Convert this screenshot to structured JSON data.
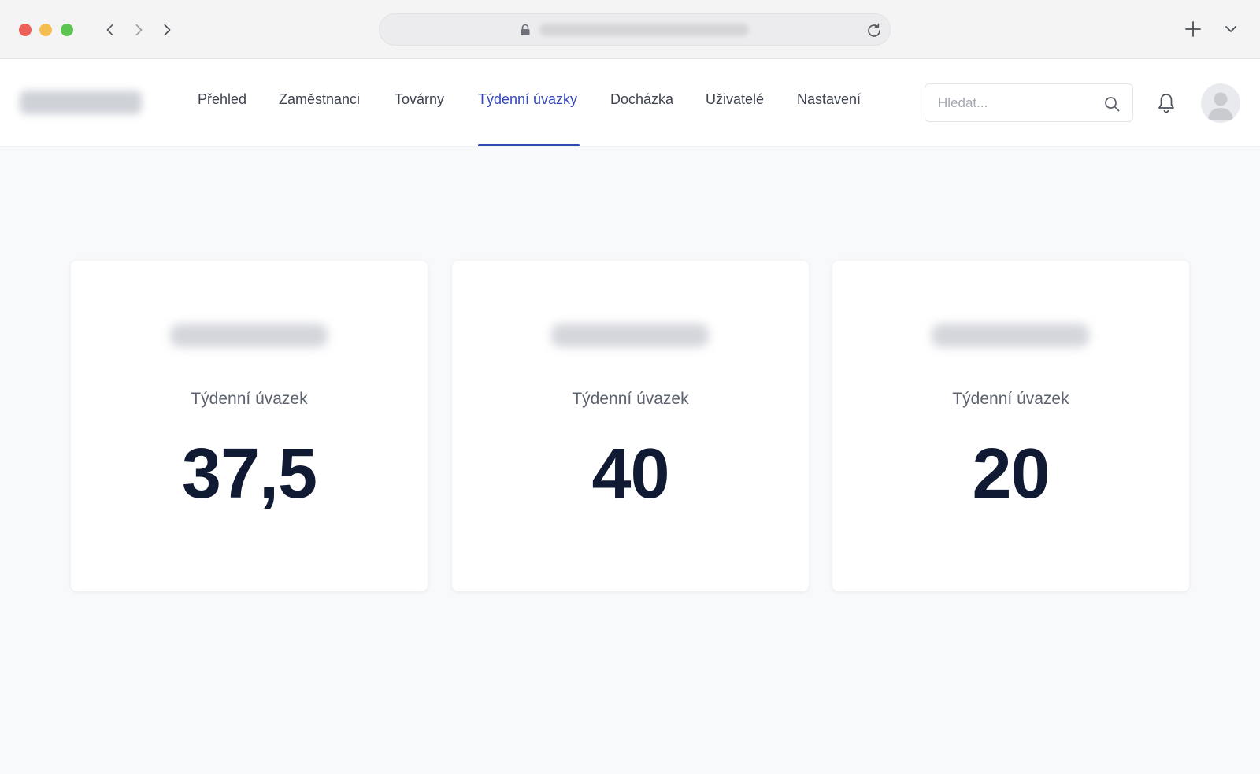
{
  "nav": {
    "items": [
      {
        "label": "Přehled"
      },
      {
        "label": "Zaměstnanci"
      },
      {
        "label": "Továrny"
      },
      {
        "label": "Týdenní úvazky"
      },
      {
        "label": "Docházka"
      },
      {
        "label": "Uživatelé"
      },
      {
        "label": "Nastavení"
      }
    ],
    "active_index": 3
  },
  "search": {
    "placeholder": "Hledat..."
  },
  "cards": [
    {
      "label": "Týdenní úvazek",
      "value": "37,5"
    },
    {
      "label": "Týdenní úvazek",
      "value": "40"
    },
    {
      "label": "Týdenní úvazek",
      "value": "20"
    }
  ],
  "colors": {
    "accent": "#3447b8",
    "value_text": "#111a33",
    "label_text": "#5c6270",
    "page_background": "#f8f9fb"
  },
  "icons": [
    "lock-icon",
    "reload-icon",
    "plus-icon",
    "chevron-down-icon",
    "search-icon",
    "bell-icon",
    "avatar-icon"
  ]
}
